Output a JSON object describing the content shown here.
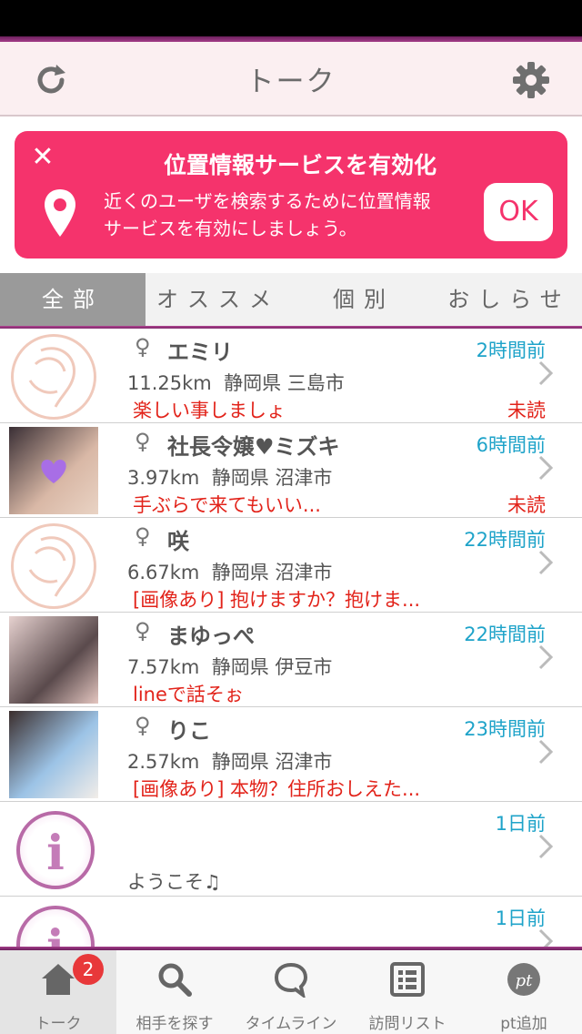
{
  "header": {
    "title": "トーク",
    "refresh_icon": "refresh-icon",
    "settings_icon": "gear-icon"
  },
  "banner": {
    "title": "位置情報サービスを有効化",
    "body_line1": "近くのユーザを検索するために位置情報",
    "body_line2": "サービスを有効にしましょう。",
    "ok_label": "OK",
    "color": "#f5336c"
  },
  "tabs": [
    {
      "label": "全部",
      "active": true
    },
    {
      "label": "オススメ",
      "active": false
    },
    {
      "label": "個別",
      "active": false
    },
    {
      "label": "おしらせ",
      "active": false
    }
  ],
  "rows": [
    {
      "gender": "♀",
      "name": "エミリ",
      "time": "2時間前",
      "distance": "11.25km",
      "location": "静岡県 三島市",
      "message": "楽しい事しましょ",
      "unread": "未読"
    },
    {
      "gender": "♀",
      "name": "社長令嬢♥ミズキ",
      "time": "6時間前",
      "distance": "3.97km",
      "location": "静岡県 沼津市",
      "message": "手ぶらで来てもいい...",
      "unread": "未読"
    },
    {
      "gender": "♀",
      "name": "咲",
      "time": "22時間前",
      "distance": "6.67km",
      "location": "静岡県 沼津市",
      "message": "[画像あり] 抱けますか？抱けま...",
      "unread": ""
    },
    {
      "gender": "♀",
      "name": "まゆっぺ",
      "time": "22時間前",
      "distance": "7.57km",
      "location": "静岡県 伊豆市",
      "message": "lineで話そぉ",
      "unread": ""
    },
    {
      "gender": "♀",
      "name": "りこ",
      "time": "23時間前",
      "distance": "2.57km",
      "location": "静岡県 沼津市",
      "message": "[画像あり] 本物？住所おしえた...",
      "unread": ""
    },
    {
      "time": "1日前",
      "message": "ようこそ♫"
    },
    {
      "time": "1日前"
    }
  ],
  "tabbar": {
    "items": [
      {
        "label": "トーク",
        "badge": "2"
      },
      {
        "label": "相手を探す"
      },
      {
        "label": "タイムライン"
      },
      {
        "label": "訪問リスト"
      },
      {
        "label": "pt追加"
      }
    ]
  }
}
